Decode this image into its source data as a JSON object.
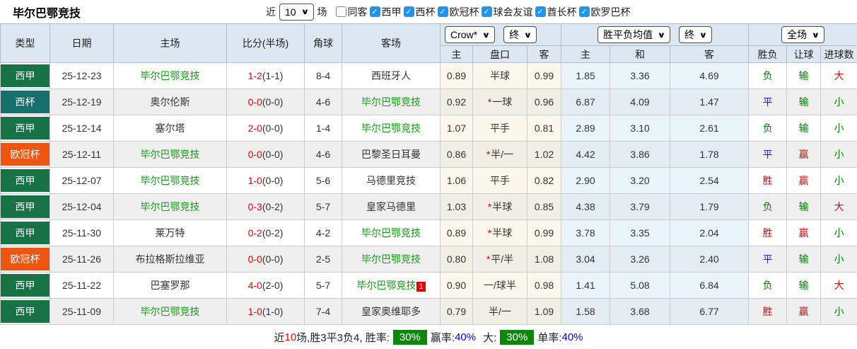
{
  "colors": {
    "type_liga": "#177245",
    "type_copa": "#15706e",
    "type_ucl": "#ee5511",
    "team_green": "#0fa00f",
    "score_red": "#ff0000",
    "red": "#cc1111",
    "green": "#008000",
    "blue": "#2222cc",
    "check_blue": "#2094f3",
    "badge_green": "#0c870c",
    "header_bg": "#dde7f1",
    "rate_blue": "#0000ee"
  },
  "header": {
    "team_name": "毕尔巴鄂竞技",
    "near_label": "近",
    "match_count": "10",
    "matches_label": "场",
    "filters": [
      {
        "label": "同客",
        "checked": false
      },
      {
        "label": "西甲",
        "checked": true
      },
      {
        "label": "西杯",
        "checked": true
      },
      {
        "label": "欧冠杯",
        "checked": true
      },
      {
        "label": "球会友谊",
        "checked": true
      },
      {
        "label": "酋长杯",
        "checked": true
      },
      {
        "label": "欧罗巴杯",
        "checked": true
      }
    ]
  },
  "table": {
    "col_headers": [
      "类型",
      "日期",
      "主场",
      "比分(半场)",
      "角球",
      "客场"
    ],
    "dropdowns": {
      "company": "Crow*",
      "company_state": "终",
      "avg": "胜平负均值",
      "avg_state": "终",
      "scope": "全场"
    },
    "sub_headers": [
      "主",
      "盘口",
      "客",
      "主",
      "和",
      "客",
      "胜负",
      "让球",
      "进球数"
    ],
    "rows": [
      {
        "type": "西甲",
        "type_color": "type_liga",
        "date": "25-12-23",
        "home": "毕尔巴鄂竞技",
        "home_green": true,
        "score": "1-2",
        "half": "(1-1)",
        "corners": "8-4",
        "away": "西班牙人",
        "away_green": false,
        "away_sup": "",
        "hcp_home": "0.89",
        "hcp_star": false,
        "hcp_line": "半球",
        "hcp_away": "0.99",
        "avg_home": "1.85",
        "avg_draw": "3.36",
        "avg_away": "4.69",
        "wdl": "负",
        "wdl_c": "green",
        "hcp_res": "输",
        "hcp_res_c": "green",
        "ou": "大",
        "ou_c": "red"
      },
      {
        "type": "西杯",
        "type_color": "type_copa",
        "date": "25-12-19",
        "home": "奥尔伦斯",
        "home_green": false,
        "score": "0-0",
        "half": "(0-0)",
        "corners": "4-6",
        "away": "毕尔巴鄂竞技",
        "away_green": true,
        "away_sup": "",
        "hcp_home": "0.92",
        "hcp_star": true,
        "hcp_line": "一球",
        "hcp_away": "0.96",
        "avg_home": "6.87",
        "avg_draw": "4.09",
        "avg_away": "1.47",
        "wdl": "平",
        "wdl_c": "blue",
        "hcp_res": "输",
        "hcp_res_c": "green",
        "ou": "小",
        "ou_c": "green"
      },
      {
        "type": "西甲",
        "type_color": "type_liga",
        "date": "25-12-14",
        "home": "塞尔塔",
        "home_green": false,
        "score": "2-0",
        "half": "(0-0)",
        "corners": "1-4",
        "away": "毕尔巴鄂竞技",
        "away_green": true,
        "away_sup": "",
        "hcp_home": "1.07",
        "hcp_star": false,
        "hcp_line": "平手",
        "hcp_away": "0.81",
        "avg_home": "2.89",
        "avg_draw": "3.10",
        "avg_away": "2.61",
        "wdl": "负",
        "wdl_c": "green",
        "hcp_res": "输",
        "hcp_res_c": "green",
        "ou": "小",
        "ou_c": "green"
      },
      {
        "type": "欧冠杯",
        "type_color": "type_ucl",
        "date": "25-12-11",
        "home": "毕尔巴鄂竞技",
        "home_green": true,
        "score": "0-0",
        "half": "(0-0)",
        "corners": "4-6",
        "away": "巴黎圣日耳曼",
        "away_green": false,
        "away_sup": "",
        "hcp_home": "0.86",
        "hcp_star": true,
        "hcp_line": "半/一",
        "hcp_away": "1.02",
        "avg_home": "4.42",
        "avg_draw": "3.86",
        "avg_away": "1.78",
        "wdl": "平",
        "wdl_c": "blue",
        "hcp_res": "赢",
        "hcp_res_c": "red",
        "ou": "小",
        "ou_c": "green"
      },
      {
        "type": "西甲",
        "type_color": "type_liga",
        "date": "25-12-07",
        "home": "毕尔巴鄂竞技",
        "home_green": true,
        "score": "1-0",
        "half": "(0-0)",
        "corners": "5-6",
        "away": "马德里竞技",
        "away_green": false,
        "away_sup": "",
        "hcp_home": "1.06",
        "hcp_star": false,
        "hcp_line": "平手",
        "hcp_away": "0.82",
        "avg_home": "2.90",
        "avg_draw": "3.20",
        "avg_away": "2.54",
        "wdl": "胜",
        "wdl_c": "red",
        "hcp_res": "赢",
        "hcp_res_c": "red",
        "ou": "小",
        "ou_c": "green"
      },
      {
        "type": "西甲",
        "type_color": "type_liga",
        "date": "25-12-04",
        "home": "毕尔巴鄂竞技",
        "home_green": true,
        "score": "0-3",
        "half": "(0-2)",
        "corners": "5-7",
        "away": "皇家马德里",
        "away_green": false,
        "away_sup": "",
        "hcp_home": "1.03",
        "hcp_star": true,
        "hcp_line": "半球",
        "hcp_away": "0.85",
        "avg_home": "4.38",
        "avg_draw": "3.79",
        "avg_away": "1.79",
        "wdl": "负",
        "wdl_c": "green",
        "hcp_res": "输",
        "hcp_res_c": "green",
        "ou": "大",
        "ou_c": "red"
      },
      {
        "type": "西甲",
        "type_color": "type_liga",
        "date": "25-11-30",
        "home": "莱万特",
        "home_green": false,
        "score": "0-2",
        "half": "(0-2)",
        "corners": "4-2",
        "away": "毕尔巴鄂竞技",
        "away_green": true,
        "away_sup": "",
        "hcp_home": "0.89",
        "hcp_star": true,
        "hcp_line": "半球",
        "hcp_away": "0.99",
        "avg_home": "3.78",
        "avg_draw": "3.35",
        "avg_away": "2.04",
        "wdl": "胜",
        "wdl_c": "red",
        "hcp_res": "赢",
        "hcp_res_c": "red",
        "ou": "小",
        "ou_c": "green"
      },
      {
        "type": "欧冠杯",
        "type_color": "type_ucl",
        "date": "25-11-26",
        "home": "布拉格斯拉维亚",
        "home_green": false,
        "score": "0-0",
        "half": "(0-0)",
        "corners": "2-5",
        "away": "毕尔巴鄂竞技",
        "away_green": true,
        "away_sup": "",
        "hcp_home": "0.80",
        "hcp_star": true,
        "hcp_line": "平/半",
        "hcp_away": "1.08",
        "avg_home": "3.04",
        "avg_draw": "3.26",
        "avg_away": "2.40",
        "wdl": "平",
        "wdl_c": "blue",
        "hcp_res": "输",
        "hcp_res_c": "green",
        "ou": "小",
        "ou_c": "green"
      },
      {
        "type": "西甲",
        "type_color": "type_liga",
        "date": "25-11-22",
        "home": "巴塞罗那",
        "home_green": false,
        "score": "4-0",
        "half": "(2-0)",
        "corners": "5-7",
        "away": "毕尔巴鄂竞技",
        "away_green": true,
        "away_sup": "1",
        "hcp_home": "0.90",
        "hcp_star": false,
        "hcp_line": "一/球半",
        "hcp_away": "0.98",
        "avg_home": "1.41",
        "avg_draw": "5.08",
        "avg_away": "6.84",
        "wdl": "负",
        "wdl_c": "green",
        "hcp_res": "输",
        "hcp_res_c": "green",
        "ou": "大",
        "ou_c": "red"
      },
      {
        "type": "西甲",
        "type_color": "type_liga",
        "date": "25-11-09",
        "home": "毕尔巴鄂竞技",
        "home_green": true,
        "score": "1-0",
        "half": "(1-0)",
        "corners": "7-4",
        "away": "皇家奥维耶多",
        "away_green": false,
        "away_sup": "",
        "hcp_home": "0.79",
        "hcp_star": false,
        "hcp_line": "半/一",
        "hcp_away": "1.09",
        "avg_home": "1.58",
        "avg_draw": "3.68",
        "avg_away": "6.77",
        "wdl": "胜",
        "wdl_c": "red",
        "hcp_res": "赢",
        "hcp_res_c": "red",
        "ou": "小",
        "ou_c": "green"
      }
    ]
  },
  "summary": {
    "part1": "近",
    "count": "10",
    "part2": "场,胜3平3负4, 胜率:",
    "win_rate": "30%",
    "label_hcp": "赢率:",
    "hcp_rate": "40%",
    "label_big": "大:",
    "big_rate": "30%",
    "label_odd": "单率:",
    "odd_rate": "40%"
  }
}
